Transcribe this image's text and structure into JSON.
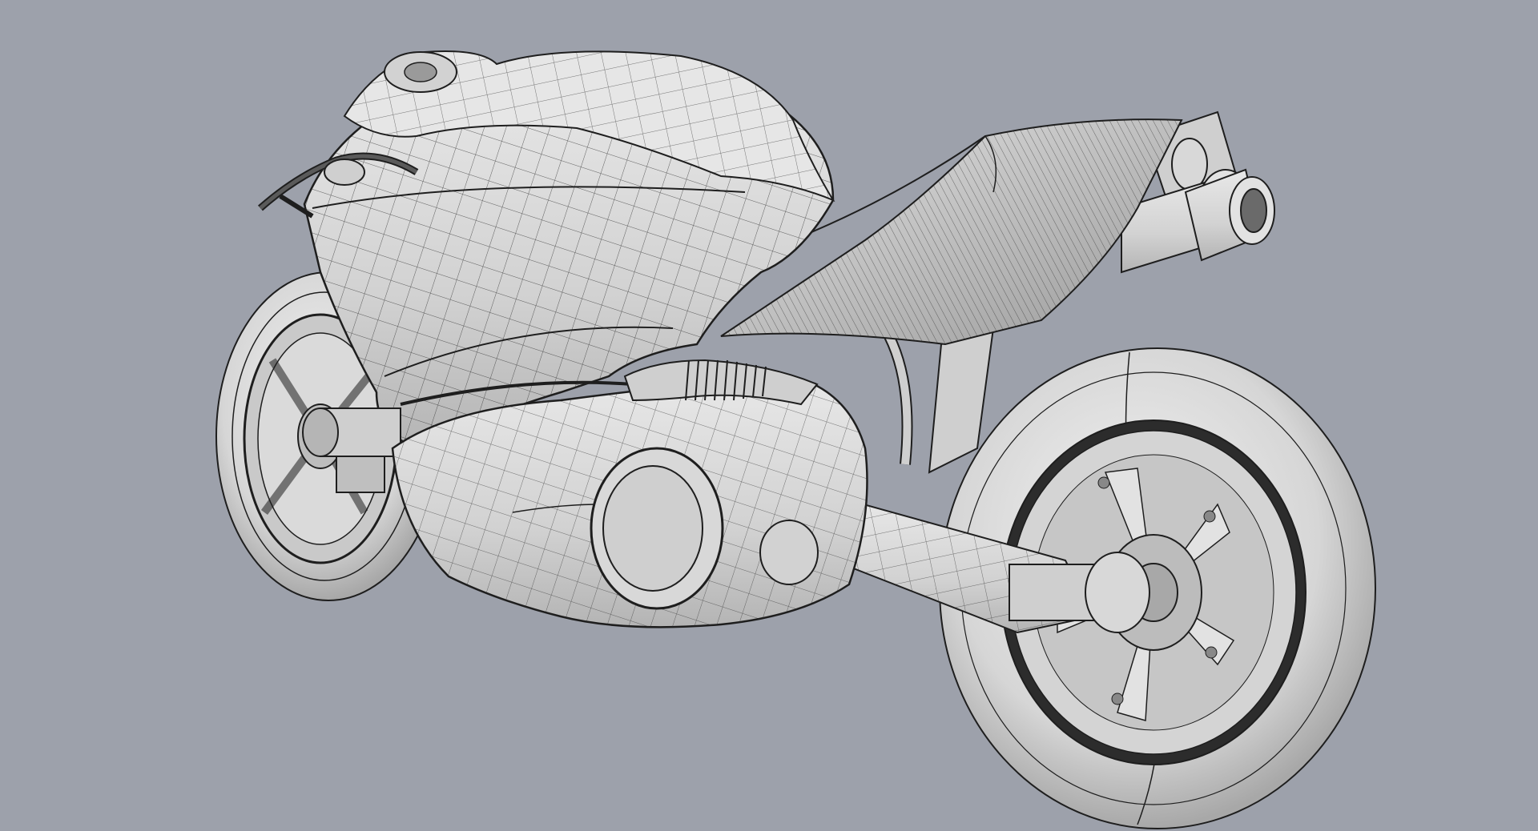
{
  "viewport": {
    "background": "#9da1ab",
    "display_mode": "shaded-wireframe"
  },
  "model": {
    "icon": "motorcycle-model",
    "surface_color": "#dcdcdc",
    "surface_shadow": "#b9b9b9",
    "edge_color": "#1e1e1e"
  }
}
